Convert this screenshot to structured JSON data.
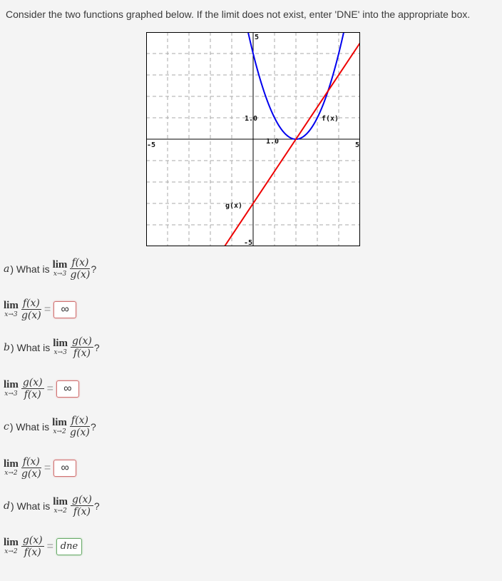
{
  "intro": "Consider the two functions graphed below. If the limit does not exist, enter 'DNE' into the appropriate box.",
  "graph": {
    "x_range": [
      -5,
      5
    ],
    "y_range": [
      -5,
      5
    ],
    "labels": {
      "x_min": "-5",
      "x_max": "5",
      "y_max": "5",
      "y_min": "-5",
      "x_tick": "1.0",
      "y_tick": "1.0",
      "f_label": "f(x)",
      "g_label": "g(x)"
    },
    "f_color": "#0000ee",
    "g_color": "#ee0000",
    "f": {
      "type": "quadratic",
      "vertex": [
        2,
        0
      ],
      "a": 1
    },
    "g": {
      "type": "line",
      "slope": 1.5,
      "intercept": -3
    }
  },
  "questions": [
    {
      "letter": "a",
      "prefix": ") What is",
      "lim_word": "lim",
      "approach": "x→3",
      "num": "f(x)",
      "den": "g(x)",
      "q": "?",
      "answer": "∞",
      "status": "incorrect"
    },
    {
      "letter": "b",
      "prefix": ") What is",
      "lim_word": "lim",
      "approach": "x→3",
      "num": "g(x)",
      "den": "f(x)",
      "q": "?",
      "answer": "∞",
      "status": "incorrect"
    },
    {
      "letter": "c",
      "prefix": ") What is",
      "lim_word": "lim",
      "approach": "x→2",
      "num": "f(x)",
      "den": "g(x)",
      "q": "?",
      "answer": "∞",
      "status": "incorrect"
    },
    {
      "letter": "d",
      "prefix": ") What is",
      "lim_word": "lim",
      "approach": "x→2",
      "num": "g(x)",
      "den": "f(x)",
      "q": "?",
      "answer": "dne",
      "status": "correct"
    }
  ],
  "eq_sign": "="
}
